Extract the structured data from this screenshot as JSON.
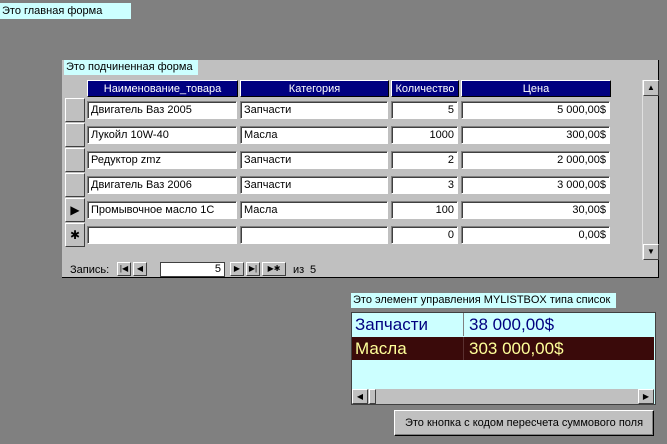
{
  "main_form": {
    "label": "Это главная форма"
  },
  "subform": {
    "label": "Это подчиненная форма",
    "columns": [
      "Наименование_товара",
      "Категория",
      "Количество",
      "Цена"
    ],
    "rows": [
      [
        "Двигатель Ваз 2005",
        "Запчасти",
        "5",
        "5 000,00$"
      ],
      [
        "Лукойл 10W-40",
        "Масла",
        "1000",
        "300,00$"
      ],
      [
        "Редуктор zmz",
        "Запчасти",
        "2",
        "2 000,00$"
      ],
      [
        "Двигатель Ваз 2006",
        "Запчасти",
        "3",
        "3 000,00$"
      ],
      [
        "Промывочное масло 1С",
        "Масла",
        "100",
        "30,00$"
      ],
      [
        "",
        "",
        "0",
        "0,00$"
      ]
    ],
    "current_row_marker": "▶",
    "new_row_marker": "✱"
  },
  "navigation": {
    "label": "Запись:",
    "current": "5",
    "of_label": "из",
    "total": "5",
    "first": "|◀",
    "prev": "◀",
    "next": "▶",
    "last": "▶|",
    "new": "▶✱"
  },
  "listbox": {
    "label": "Это элемент управления MYLISTBOX типа список",
    "items": [
      {
        "category": "Запчасти",
        "sum": "38 000,00$",
        "selected": false
      },
      {
        "category": "Масла",
        "sum": "303 000,00$",
        "selected": true
      }
    ],
    "colors": {
      "text": "#000080",
      "selected_bg": "#3a0a0a",
      "selected_text": "#ffff99",
      "bg": "#ccffff"
    }
  },
  "recalc_button": {
    "label": "Это кнопка с кодом пересчета суммового поля"
  },
  "colors": {
    "form_bg": "#808080",
    "subform_bg": "#c0c0c0",
    "label_bg": "#ccffff",
    "header_bg": "#000080"
  }
}
